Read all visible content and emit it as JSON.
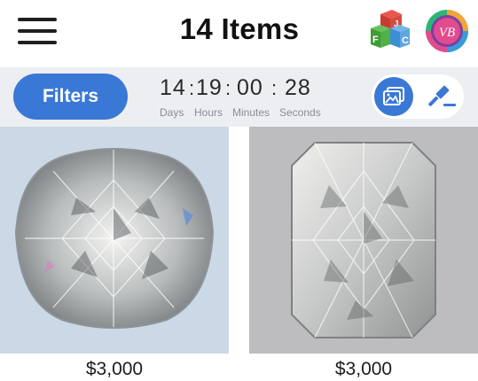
{
  "header": {
    "title": "14 Items",
    "menu_icon": "hamburger-menu-icon",
    "app_icon": "abc-blocks-icon",
    "profile_badge_icon": "monogram-badge-icon",
    "badge_colors": [
      "#e24b8e",
      "#2bb673",
      "#7b3fa0",
      "#f2a33a"
    ]
  },
  "toolbar": {
    "filters_label": "Filters",
    "timer": {
      "days": "14",
      "hours": "19",
      "minutes": "00",
      "seconds": "28",
      "days_label": "Days",
      "hours_label": "Hours",
      "minutes_label": "Minutes",
      "seconds_label": "Seconds"
    },
    "view_toggle": {
      "photo_icon": "photo-gallery-icon",
      "auction_icon": "gavel-icon",
      "active": "photo"
    }
  },
  "items": [
    {
      "shape": "cushion",
      "price": "$3,000",
      "image": "cushion-cut-diamond-image"
    },
    {
      "shape": "radiant",
      "price": "$3,000",
      "image": "radiant-cut-diamond-image"
    }
  ],
  "colors": {
    "accent": "#3a78d6",
    "toolbar_bg": "#eceef1"
  }
}
